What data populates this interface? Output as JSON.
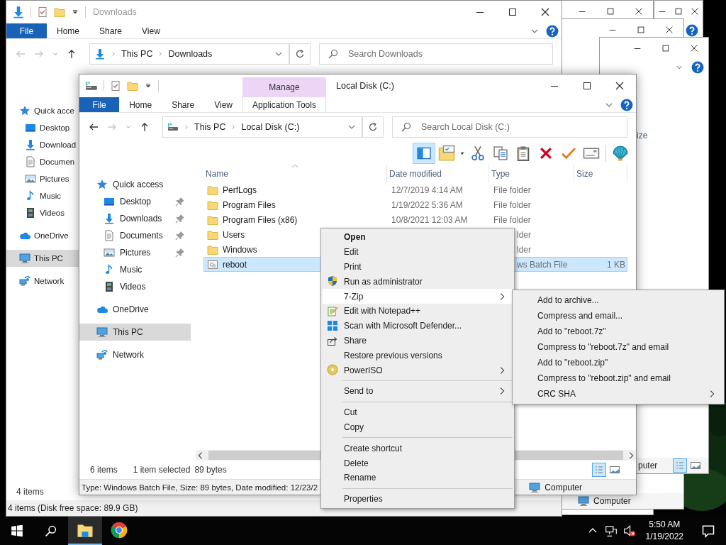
{
  "downloads_window": {
    "title": "Downloads",
    "tabs": [
      {
        "label": "File",
        "kind": "file"
      },
      {
        "label": "Home",
        "kind": "tab"
      },
      {
        "label": "Share",
        "kind": "tab"
      },
      {
        "label": "View",
        "kind": "tab"
      }
    ],
    "navigation": {
      "back_enabled": false,
      "forward_enabled": false
    },
    "address": [
      "This PC",
      "Downloads"
    ],
    "search": {
      "placeholder": "Search Downloads"
    },
    "sidebar": {
      "items": [
        {
          "label": "Quick acce",
          "selected": false,
          "children": [
            {
              "label": "Desktop",
              "selected": false
            },
            {
              "label": "Download",
              "selected": false
            },
            {
              "label": "Documen",
              "selected": false
            },
            {
              "label": "Pictures",
              "selected": false
            },
            {
              "label": "Music",
              "selected": false
            },
            {
              "label": "Videos",
              "selected": false
            }
          ]
        },
        {
          "label": "OneDrive",
          "selected": false
        },
        {
          "label": "This PC",
          "selected": true
        },
        {
          "label": "Network",
          "selected": false
        }
      ]
    },
    "item_count": "4 items",
    "status_bar": "4 items (Disk free space: 89.9 GB)"
  },
  "background_windows": [
    {
      "fragment": "ize"
    },
    {
      "fragment": "puter"
    },
    {
      "fragment": "Computer"
    }
  ],
  "explorer_window": {
    "title": "Local Disk (C:)",
    "context_tab": "Manage",
    "tabs": [
      {
        "label": "File",
        "kind": "file"
      },
      {
        "label": "Home",
        "kind": "tab"
      },
      {
        "label": "Share",
        "kind": "tab"
      },
      {
        "label": "View",
        "kind": "tab"
      },
      {
        "label": "Application Tools",
        "kind": "contextual"
      }
    ],
    "navigation": {
      "back_enabled": true,
      "forward_enabled": false
    },
    "address": [
      "This PC",
      "Local Disk (C:)"
    ],
    "search": {
      "placeholder": "Search Local Disk (C:)"
    },
    "toolbar": {
      "preview_pane_on": true
    },
    "sidebar": {
      "items": [
        {
          "label": "Quick access",
          "selected": false,
          "children": [
            {
              "label": "Desktop",
              "selected": false,
              "pinned": true
            },
            {
              "label": "Downloads",
              "selected": false,
              "pinned": true
            },
            {
              "label": "Documents",
              "selected": false,
              "pinned": true
            },
            {
              "label": "Pictures",
              "selected": false,
              "pinned": true
            },
            {
              "label": "Music",
              "selected": false,
              "pinned": false
            },
            {
              "label": "Videos",
              "selected": false,
              "pinned": false
            }
          ]
        },
        {
          "label": "OneDrive",
          "selected": false
        },
        {
          "label": "This PC",
          "selected": true
        },
        {
          "label": "Network",
          "selected": false
        }
      ]
    },
    "columns": [
      {
        "label": "Name",
        "sorted": true
      },
      {
        "label": "Date modified",
        "sorted": false
      },
      {
        "label": "Type",
        "sorted": false
      },
      {
        "label": "Size",
        "sorted": false
      }
    ],
    "rows": [
      {
        "kind": "folder",
        "name": "PerfLogs",
        "date": "12/7/2019 4:14 AM",
        "type": "File folder",
        "selected": false
      },
      {
        "kind": "folder",
        "name": "Program Files",
        "date": "1/19/2022 5:36 AM",
        "type": "File folder",
        "selected": false
      },
      {
        "kind": "folder",
        "name": "Program Files (x86)",
        "date": "10/8/2021 12:03 AM",
        "type": "File folder",
        "selected": false
      },
      {
        "kind": "folder",
        "name": "Users",
        "type": "lder",
        "selected": false
      },
      {
        "kind": "folder",
        "name": "Windows",
        "type": "lder",
        "selected": false
      },
      {
        "kind": "batch",
        "name": "reboot",
        "type": "ws Batch File",
        "size": "1 KB",
        "selected": true
      }
    ],
    "status": {
      "item_count": "6 items",
      "selection": "1 item selected",
      "selection_size": "89 bytes"
    },
    "details_view": true,
    "details_bar": "Type: Windows Batch File, Size: 89 bytes, Date modified: 12/23/2",
    "zone": "Computer"
  },
  "context_menu": {
    "items": [
      {
        "kind": "item",
        "label": "Open",
        "default": true,
        "submenu": false,
        "selected": false
      },
      {
        "kind": "item",
        "label": "Edit",
        "default": false,
        "submenu": false,
        "selected": false
      },
      {
        "kind": "item",
        "label": "Print",
        "default": false,
        "submenu": false,
        "selected": false
      },
      {
        "kind": "item",
        "label": "Run as administrator",
        "default": false,
        "submenu": false,
        "selected": false
      },
      {
        "kind": "item",
        "label": "7-Zip",
        "default": false,
        "submenu": true,
        "selected": true
      },
      {
        "kind": "item",
        "label": "Edit with Notepad++",
        "default": false,
        "submenu": false,
        "selected": false
      },
      {
        "kind": "item",
        "label": "Scan with Microsoft Defender...",
        "default": false,
        "submenu": false,
        "selected": false
      },
      {
        "kind": "item",
        "label": "Share",
        "default": false,
        "submenu": false,
        "selected": false
      },
      {
        "kind": "item",
        "label": "Restore previous versions",
        "default": false,
        "submenu": false,
        "selected": false
      },
      {
        "kind": "item",
        "label": "PowerISO",
        "default": false,
        "submenu": true,
        "selected": false
      },
      {
        "kind": "separator"
      },
      {
        "kind": "item",
        "label": "Send to",
        "default": false,
        "submenu": true,
        "selected": false
      },
      {
        "kind": "separator"
      },
      {
        "kind": "item",
        "label": "Cut",
        "default": false,
        "submenu": false,
        "selected": false
      },
      {
        "kind": "item",
        "label": "Copy",
        "default": false,
        "submenu": false,
        "selected": false
      },
      {
        "kind": "separator"
      },
      {
        "kind": "item",
        "label": "Create shortcut",
        "default": false,
        "submenu": false,
        "selected": false
      },
      {
        "kind": "item",
        "label": "Delete",
        "default": false,
        "submenu": false,
        "selected": false
      },
      {
        "kind": "item",
        "label": "Rename",
        "default": false,
        "submenu": false,
        "selected": false
      },
      {
        "kind": "separator"
      },
      {
        "kind": "item",
        "label": "Properties",
        "default": false,
        "submenu": false,
        "selected": false
      }
    ]
  },
  "submenu": {
    "items": [
      {
        "label": "Add to archive...",
        "submenu": false,
        "selected": false
      },
      {
        "label": "Compress and email...",
        "submenu": false,
        "selected": false
      },
      {
        "label": "Add to \"reboot.7z\"",
        "submenu": false,
        "selected": false
      },
      {
        "label": "Compress to \"reboot.7z\" and email",
        "submenu": false,
        "selected": false
      },
      {
        "label": "Add to \"reboot.zip\"",
        "submenu": false,
        "selected": false
      },
      {
        "label": "Compress to \"reboot.zip\" and email",
        "submenu": false,
        "selected": false
      },
      {
        "label": "CRC SHA",
        "submenu": true,
        "selected": false
      }
    ]
  },
  "taskbar": {
    "apps": [
      {
        "active": true
      },
      {
        "active": false
      }
    ],
    "time": "5:50 AM",
    "date": "1/19/2022"
  }
}
